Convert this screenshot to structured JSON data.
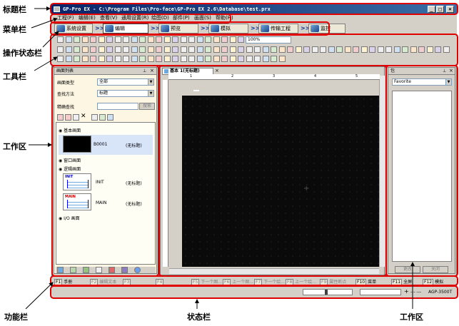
{
  "annotations": {
    "title_bar": "标题栏",
    "menu_bar": "菜单栏",
    "ops_bar": "操作状态栏",
    "toolbar": "工具栏",
    "workspace_left": "工作区",
    "workspace_right": "工作区",
    "function_bar": "功能栏",
    "status_bar": "状态栏"
  },
  "window": {
    "title": "GP-Pro EX - C:\\Program Files\\Pro-face\\GP-Pro EX 2.6\\Database\\test.prx",
    "min": "_",
    "max": "□",
    "close": "×"
  },
  "menu": [
    "工程(F)",
    "编辑(E)",
    "查看(V)",
    "通用设置(R)",
    "绘图(D)",
    "部件(P)",
    "画面(S)",
    "帮助(H)"
  ],
  "ops": {
    "sysconf": "系统设置",
    "edit": "编辑",
    "preview": "预览",
    "simulate": "模拟",
    "transfer": "传输工程",
    "monitor": "监控",
    "sep": ">>"
  },
  "zoom": "100%",
  "screen_list": {
    "header": "画面列表",
    "type_label": "画面类型",
    "type_value": "全部",
    "search_label": "查找方法",
    "search_value": "标题",
    "exact_label": "精确查找",
    "search_btn": "搜索",
    "group_base": "基本画面",
    "group_window": "窗口画面",
    "group_logic": "逻辑画面",
    "group_io": "I/O 画面",
    "items": [
      {
        "id": "B0001",
        "title": "(无标题)"
      },
      {
        "id": "INIT",
        "title": "(无标题)"
      },
      {
        "id": "MAIN",
        "title": "(无标题)"
      }
    ],
    "thumb_init": "INIT",
    "thumb_main": "MAIN"
  },
  "editor": {
    "tab": "基本 1(无标题)",
    "tab_close": "×",
    "ruler": [
      "1",
      "2",
      "3",
      "4",
      "5"
    ]
  },
  "package": {
    "header": "包",
    "value": "Favorite",
    "btn_change": "更改",
    "btn_close": "关闭"
  },
  "function_keys": [
    {
      "key": "F1",
      "label": "手册",
      "on": true
    },
    {
      "key": "F2",
      "label": "编辑文本",
      "on": false
    },
    {
      "key": "F3",
      "label": "",
      "on": false
    },
    {
      "key": "F4",
      "label": "",
      "on": false
    },
    {
      "key": "F5",
      "label": "下一个图...",
      "on": false
    },
    {
      "key": "F6",
      "label": "上一个图...",
      "on": false
    },
    {
      "key": "F7",
      "label": "下一个绘...",
      "on": false
    },
    {
      "key": "F8",
      "label": "上一个绘...",
      "on": false
    },
    {
      "key": "F9",
      "label": "属性断点",
      "on": false
    },
    {
      "key": "F10",
      "label": "菜单",
      "on": true
    },
    {
      "key": "F11",
      "label": "全屏",
      "on": true
    },
    {
      "key": "F12",
      "label": "模拟",
      "on": true
    }
  ],
  "status": {
    "device": "AGP-3500T",
    "plus": "+",
    "coords": "---  ---"
  },
  "colors": {
    "callout": "#e00000",
    "titlebar": "#0a246a",
    "canvas": "#0a0a0a"
  }
}
